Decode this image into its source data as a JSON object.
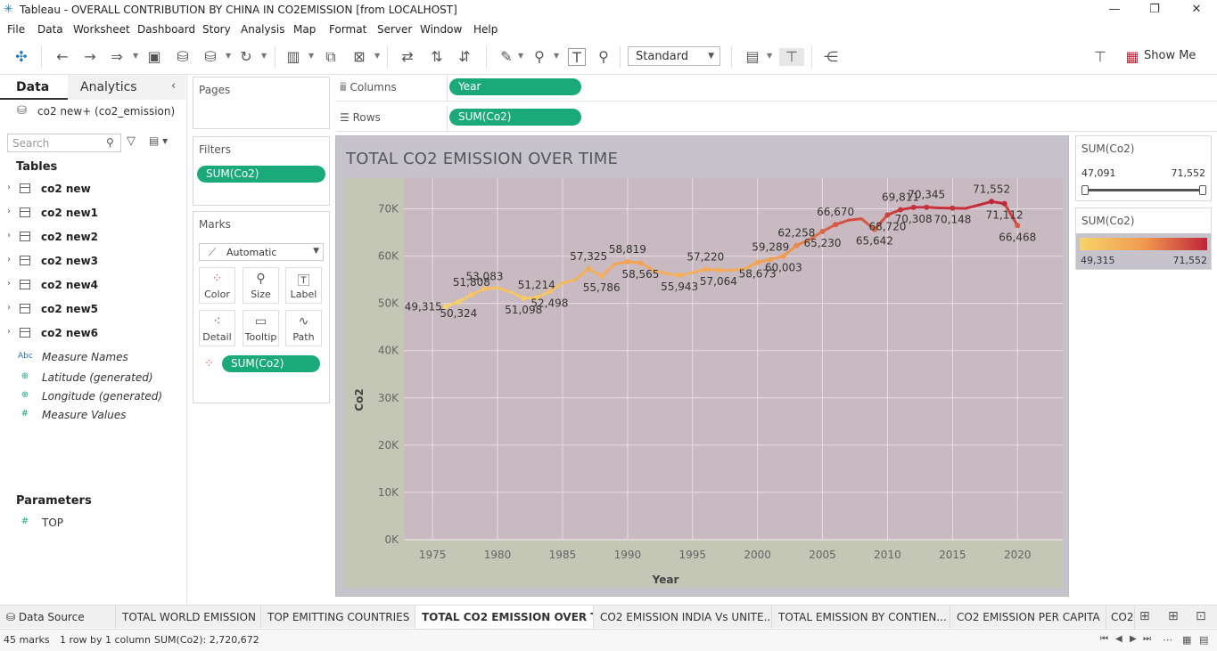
{
  "window": {
    "title": "Tableau - OVERALL CONTRIBUTION BY CHINA IN CO2EMISSION [from LOCALHOST]"
  },
  "menu": [
    "File",
    "Data",
    "Worksheet",
    "Dashboard",
    "Story",
    "Analysis",
    "Map",
    "Format",
    "Server",
    "Window",
    "Help"
  ],
  "toolbar": {
    "fit_value": "Standard",
    "show_me": "Show Me"
  },
  "left": {
    "tab_data": "Data",
    "tab_analytics": "Analytics",
    "datasource": "co2 new+ (co2_emission)",
    "search_placeholder": "Search",
    "tables_header": "Tables",
    "tables": [
      "co2 new",
      "co2 new1",
      "co2 new2",
      "co2 new3",
      "co2 new4",
      "co2 new5",
      "co2 new6"
    ],
    "fields": [
      {
        "icon": "Abc",
        "label": "Measure Names"
      },
      {
        "icon": "globe-icon",
        "label": "Latitude (generated)"
      },
      {
        "icon": "globe-icon",
        "label": "Longitude (generated)"
      },
      {
        "icon": "#",
        "label": "Measure Values"
      }
    ],
    "parameters_header": "Parameters",
    "parameters": [
      {
        "icon": "#",
        "label": "TOP"
      }
    ]
  },
  "cards": {
    "pages": "Pages",
    "filters": "Filters",
    "filter_pill": "SUM(Co2)",
    "marks": "Marks",
    "mark_type": "Automatic",
    "mark_buttons": [
      "Color",
      "Size",
      "Label",
      "Detail",
      "Tooltip",
      "Path"
    ],
    "color_pill": "SUM(Co2)"
  },
  "shelves": {
    "columns_label": "Columns",
    "columns_pill": "Year",
    "rows_label": "Rows",
    "rows_pill": "SUM(Co2)"
  },
  "viz": {
    "title": "TOTAL CO2 EMISSION OVER TIME"
  },
  "legend": {
    "filter_title": "SUM(Co2)",
    "filter_min": "47,091",
    "filter_max": "71,552",
    "color_title": "SUM(Co2)",
    "color_min": "49,315",
    "color_max": "71,552",
    "color_low": "#f7d36b",
    "color_high": "#c0243a"
  },
  "chart_data": {
    "type": "line",
    "xlabel": "Year",
    "ylabel": "Co2",
    "xlim": [
      1973,
      2023
    ],
    "ylim": [
      0,
      75000
    ],
    "x_ticks": [
      "1975",
      "1980",
      "1985",
      "1990",
      "1995",
      "2000",
      "2005",
      "2010",
      "2015",
      "2020"
    ],
    "y_ticks": [
      "0K",
      "10K",
      "20K",
      "30K",
      "40K",
      "50K",
      "60K",
      "70K"
    ],
    "grid": true,
    "points": [
      {
        "x": 1976,
        "y": 49315
      },
      {
        "x": 1977,
        "y": 50324
      },
      {
        "x": 1978,
        "y": 51808
      },
      {
        "x": 1979,
        "y": 53083
      },
      {
        "x": 1980,
        "y": 53300
      },
      {
        "x": 1981,
        "y": 52400
      },
      {
        "x": 1982,
        "y": 51098
      },
      {
        "x": 1983,
        "y": 51214
      },
      {
        "x": 1984,
        "y": 52498
      },
      {
        "x": 1985,
        "y": 54300
      },
      {
        "x": 1986,
        "y": 55000
      },
      {
        "x": 1987,
        "y": 57325
      },
      {
        "x": 1988,
        "y": 55786
      },
      {
        "x": 1989,
        "y": 58300
      },
      {
        "x": 1990,
        "y": 58819
      },
      {
        "x": 1991,
        "y": 58565
      },
      {
        "x": 1992,
        "y": 57000
      },
      {
        "x": 1993,
        "y": 56300
      },
      {
        "x": 1994,
        "y": 55943
      },
      {
        "x": 1995,
        "y": 56500
      },
      {
        "x": 1996,
        "y": 57220
      },
      {
        "x": 1997,
        "y": 57064
      },
      {
        "x": 1998,
        "y": 57000
      },
      {
        "x": 1999,
        "y": 57300
      },
      {
        "x": 2000,
        "y": 58673
      },
      {
        "x": 2001,
        "y": 59289
      },
      {
        "x": 2002,
        "y": 60003
      },
      {
        "x": 2003,
        "y": 62258
      },
      {
        "x": 2004,
        "y": 63500
      },
      {
        "x": 2005,
        "y": 65230
      },
      {
        "x": 2006,
        "y": 66670
      },
      {
        "x": 2007,
        "y": 67600
      },
      {
        "x": 2008,
        "y": 67900
      },
      {
        "x": 2009,
        "y": 65642
      },
      {
        "x": 2010,
        "y": 68720
      },
      {
        "x": 2011,
        "y": 69811
      },
      {
        "x": 2012,
        "y": 70308
      },
      {
        "x": 2013,
        "y": 70345
      },
      {
        "x": 2014,
        "y": 70200
      },
      {
        "x": 2015,
        "y": 70148
      },
      {
        "x": 2016,
        "y": 70100
      },
      {
        "x": 2017,
        "y": 70800
      },
      {
        "x": 2018,
        "y": 71552
      },
      {
        "x": 2019,
        "y": 71112
      },
      {
        "x": 2020,
        "y": 66468
      }
    ],
    "labels": [
      {
        "x": 1976,
        "y": 49315,
        "text": "49,315",
        "pos": "left"
      },
      {
        "x": 1977,
        "y": 50324,
        "text": "50,324",
        "pos": "below"
      },
      {
        "x": 1978,
        "y": 51808,
        "text": "51,808",
        "pos": "above"
      },
      {
        "x": 1979,
        "y": 53083,
        "text": "53,083",
        "pos": "above"
      },
      {
        "x": 1982,
        "y": 51098,
        "text": "51,098",
        "pos": "below"
      },
      {
        "x": 1983,
        "y": 51214,
        "text": "51,214",
        "pos": "above"
      },
      {
        "x": 1984,
        "y": 52498,
        "text": "52,498",
        "pos": "below"
      },
      {
        "x": 1987,
        "y": 57325,
        "text": "57,325",
        "pos": "above"
      },
      {
        "x": 1988,
        "y": 55786,
        "text": "55,786",
        "pos": "below"
      },
      {
        "x": 1990,
        "y": 58819,
        "text": "58,819",
        "pos": "above"
      },
      {
        "x": 1991,
        "y": 58565,
        "text": "58,565",
        "pos": "below"
      },
      {
        "x": 1994,
        "y": 55943,
        "text": "55,943",
        "pos": "below"
      },
      {
        "x": 1996,
        "y": 57220,
        "text": "57,220",
        "pos": "above"
      },
      {
        "x": 1997,
        "y": 57064,
        "text": "57,064",
        "pos": "below"
      },
      {
        "x": 2000,
        "y": 58673,
        "text": "58,673",
        "pos": "below"
      },
      {
        "x": 2001,
        "y": 59289,
        "text": "59,289",
        "pos": "above"
      },
      {
        "x": 2002,
        "y": 60003,
        "text": "60,003",
        "pos": "below"
      },
      {
        "x": 2003,
        "y": 62258,
        "text": "62,258",
        "pos": "above"
      },
      {
        "x": 2005,
        "y": 65230,
        "text": "65,230",
        "pos": "below"
      },
      {
        "x": 2006,
        "y": 66670,
        "text": "66,670",
        "pos": "above"
      },
      {
        "x": 2009,
        "y": 65642,
        "text": "65,642",
        "pos": "below"
      },
      {
        "x": 2010,
        "y": 68720,
        "text": "68,720",
        "pos": "below"
      },
      {
        "x": 2011,
        "y": 69811,
        "text": "69,811",
        "pos": "above"
      },
      {
        "x": 2012,
        "y": 70308,
        "text": "70,308",
        "pos": "below"
      },
      {
        "x": 2013,
        "y": 70345,
        "text": "70,345",
        "pos": "above"
      },
      {
        "x": 2015,
        "y": 70148,
        "text": "70,148",
        "pos": "below"
      },
      {
        "x": 2018,
        "y": 71552,
        "text": "71,552",
        "pos": "above"
      },
      {
        "x": 2019,
        "y": 71112,
        "text": "71,112",
        "pos": "below"
      },
      {
        "x": 2020,
        "y": 66468,
        "text": "66,468",
        "pos": "below"
      }
    ]
  },
  "tabs": [
    {
      "label": "Data Source"
    },
    {
      "label": "TOTAL WORLD EMISSION"
    },
    {
      "label": "TOP EMITTING COUNTRIES"
    },
    {
      "label": "TOTAL CO2 EMISSION OVER T..."
    },
    {
      "label": "CO2 EMISSION INDIA Vs UNITE..."
    },
    {
      "label": "TOTAL EMISSION BY CONTIEN..."
    },
    {
      "label": "CO2 EMISSION PER CAPITA"
    },
    {
      "label": "CO2"
    }
  ],
  "status": {
    "marks": "45 marks",
    "rows": "1 row by 1 column",
    "sum": "SUM(Co2): 2,720,672"
  }
}
